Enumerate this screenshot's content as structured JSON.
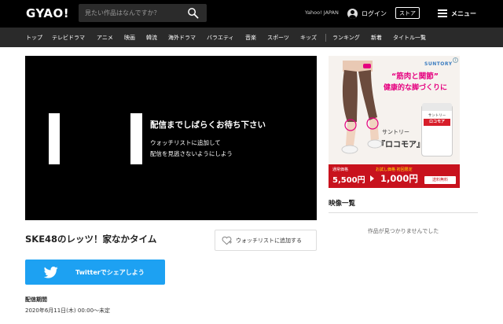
{
  "header": {
    "logo": "GYAO!",
    "search_placeholder": "見たい作品はなんですか？",
    "yahoo_link": "Yahoo! JAPAN",
    "login_label": "ログイン",
    "store_label": "ストア",
    "menu_label": "メニュー"
  },
  "nav": {
    "items": [
      "トップ",
      "テレビドラマ",
      "アニメ",
      "映画",
      "韓流",
      "海外ドラマ",
      "バラエティ",
      "音楽",
      "スポーツ",
      "キッズ",
      "ランキング",
      "新着",
      "タイトル一覧"
    ]
  },
  "player": {
    "message": "配信までしばらくお待ち下さい",
    "sub_line1": "ウォッチリストに追加して",
    "sub_line2": "配信を見逃さないようにしよう"
  },
  "video": {
    "title": "SKE48のレッツ！家なかタイム",
    "watchlist_label": "ウォッチリストに追加する",
    "twitter_label": "Twitterでシェアしよう",
    "period_label": "配信期間",
    "period_value": "2020年6月11日(木) 00:00〜未定"
  },
  "ad": {
    "brand": "SUNTORY",
    "headline1": "“筋肉と関節”",
    "headline2": "健康的な脚づくりに",
    "product_brand": "サントリー",
    "product_name": "ロコモア",
    "brand_line1": "サントリー",
    "brand_line2": "『ロコモア』",
    "regular_label": "通常価格",
    "regular_price": "5,500円",
    "trial_label": "お試し価格 初回限定",
    "trial_price": "1,000円",
    "shipping_label": "送料無料",
    "colors": {
      "accent": "#e5007f",
      "banner": "#c8121d"
    }
  },
  "sidebar": {
    "title": "映像一覧",
    "empty_message": "作品が見つかりませんでした"
  },
  "colors": {
    "twitter": "#1da1f2",
    "header": "#000000",
    "nav": "#2a2a2a"
  }
}
